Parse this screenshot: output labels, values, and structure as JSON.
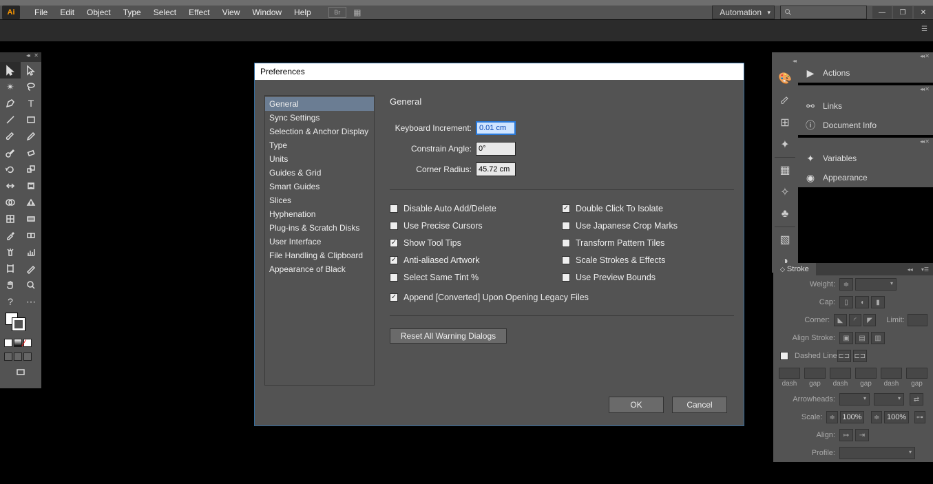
{
  "menu": {
    "items": [
      "File",
      "Edit",
      "Object",
      "Type",
      "Select",
      "Effect",
      "View",
      "Window",
      "Help"
    ],
    "workspace": "Automation"
  },
  "tools": [
    [
      "selection",
      "direct-select"
    ],
    [
      "wand",
      "lasso"
    ],
    [
      "pen",
      "type"
    ],
    [
      "line",
      "rect"
    ],
    [
      "brush",
      "pencil"
    ],
    [
      "blob",
      "eraser"
    ],
    [
      "rotate",
      "scale"
    ],
    [
      "width",
      "warp"
    ],
    [
      "shape-builder",
      "perspective"
    ],
    [
      "mesh",
      "gradient"
    ],
    [
      "eyedrop",
      "blend"
    ],
    [
      "spray",
      "graph"
    ],
    [
      "artboard",
      "slice"
    ],
    [
      "hand",
      "zoom"
    ],
    [
      "fill-q",
      "?"
    ]
  ],
  "right_dock_icons": [
    "palette",
    "brush-def",
    "swatch",
    "symbols",
    "grid",
    "sparkle",
    "club",
    "color",
    "gradient-ico"
  ],
  "panels": {
    "group1": [
      {
        "icon": "▶",
        "label": "Actions"
      }
    ],
    "group2": [
      {
        "icon": "⊂⊃",
        "label": "Links"
      },
      {
        "icon": "ⓘ",
        "label": "Document Info"
      }
    ],
    "group3": [
      {
        "icon": "✦",
        "label": "Variables"
      },
      {
        "icon": "◉",
        "label": "Appearance"
      }
    ]
  },
  "stroke": {
    "title": "Stroke",
    "weight_lbl": "Weight:",
    "cap_lbl": "Cap:",
    "corner_lbl": "Corner:",
    "limit_lbl": "Limit:",
    "align_lbl": "Align Stroke:",
    "dashed_lbl": "Dashed Line",
    "dash_labels": [
      "dash",
      "gap",
      "dash",
      "gap",
      "dash",
      "gap"
    ],
    "arrow_lbl": "Arrowheads:",
    "scale_lbl": "Scale:",
    "scale_v1": "100%",
    "scale_v2": "100%",
    "align2_lbl": "Align:",
    "profile_lbl": "Profile:"
  },
  "dialog": {
    "title": "Preferences",
    "categories": [
      "General",
      "Sync Settings",
      "Selection & Anchor Display",
      "Type",
      "Units",
      "Guides & Grid",
      "Smart Guides",
      "Slices",
      "Hyphenation",
      "Plug-ins & Scratch Disks",
      "User Interface",
      "File Handling & Clipboard",
      "Appearance of Black"
    ],
    "selected": 0,
    "section": "General",
    "fields": {
      "keyboard_lbl": "Keyboard Increment:",
      "keyboard_val": "0.01 cm",
      "constrain_lbl": "Constrain Angle:",
      "constrain_val": "0°",
      "corner_lbl": "Corner Radius:",
      "corner_val": "45.72 cm"
    },
    "checks_left": [
      {
        "label": "Disable Auto Add/Delete",
        "checked": false
      },
      {
        "label": "Use Precise Cursors",
        "checked": false
      },
      {
        "label": "Show Tool Tips",
        "checked": true
      },
      {
        "label": "Anti-aliased Artwork",
        "checked": true
      },
      {
        "label": "Select Same Tint %",
        "checked": false
      }
    ],
    "checks_right": [
      {
        "label": "Double Click To Isolate",
        "checked": true
      },
      {
        "label": "Use Japanese Crop Marks",
        "checked": false
      },
      {
        "label": "Transform Pattern Tiles",
        "checked": false
      },
      {
        "label": "Scale Strokes & Effects",
        "checked": false
      },
      {
        "label": "Use Preview Bounds",
        "checked": false
      }
    ],
    "check_bottom": {
      "label": "Append [Converted] Upon Opening Legacy Files",
      "checked": true
    },
    "reset": "Reset All Warning Dialogs",
    "ok": "OK",
    "cancel": "Cancel"
  }
}
